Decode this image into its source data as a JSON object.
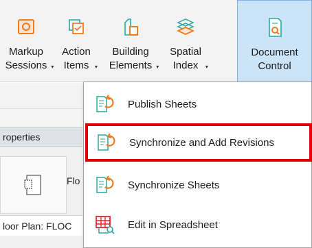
{
  "ribbon": {
    "tools": [
      {
        "id": "markup-sessions",
        "line1": "Markup",
        "line2": "Sessions",
        "icon": "markup-sessions-icon"
      },
      {
        "id": "action-items",
        "line1": "Action",
        "line2": "Items",
        "icon": "action-items-icon"
      },
      {
        "id": "building-elements",
        "line1": "Building",
        "line2": "Elements",
        "icon": "building-elements-icon"
      },
      {
        "id": "spatial-index",
        "line1": "Spatial",
        "line2": "Index",
        "icon": "spatial-index-icon"
      },
      {
        "id": "document-control",
        "line1": "Document",
        "line2": "Control",
        "icon": "document-control-icon"
      }
    ],
    "active_tool": "document-control"
  },
  "properties": {
    "header": "roperties",
    "type_label": "Flo",
    "view_field": "loor Plan: FLOC"
  },
  "menu": {
    "items": [
      {
        "label": "Publish Sheets",
        "icon": "publish-sheets-icon"
      },
      {
        "label": "Synchronize and Add Revisions",
        "icon": "sync-revisions-icon",
        "highlighted": true
      },
      {
        "label": "Synchronize Sheets",
        "icon": "sync-sheets-icon"
      },
      {
        "label": "Edit in Spreadsheet",
        "icon": "spreadsheet-icon"
      }
    ]
  },
  "colors": {
    "highlight": "#e00000",
    "icon_teal": "#2aa6a0",
    "icon_orange": "#f07a1e",
    "active_tool_bg": "#cce4f7"
  }
}
